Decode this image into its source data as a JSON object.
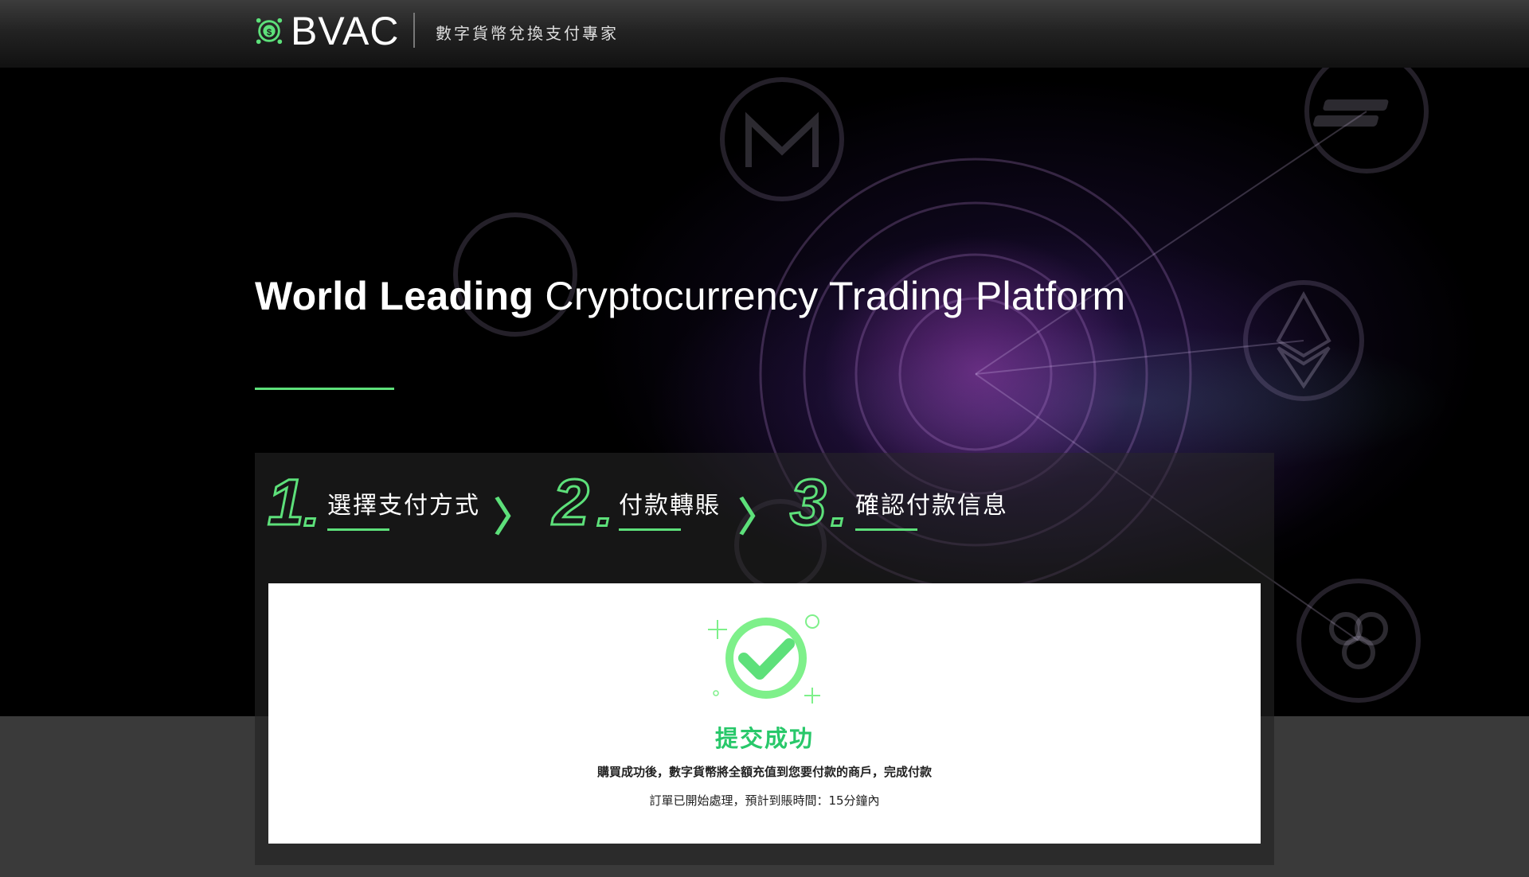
{
  "header": {
    "brand": "BVAC",
    "tagline": "數字貨幣兌換支付專家"
  },
  "hero": {
    "title_bold": "World Leading",
    "title_rest": "Cryptocurrency Trading Platform",
    "accent_color": "#5de07a"
  },
  "steps": [
    {
      "number": "1",
      "label": "選擇支付方式"
    },
    {
      "number": "2",
      "label": "付款轉賬"
    },
    {
      "number": "3",
      "label": "確認付款信息"
    }
  ],
  "step_separator": "〉",
  "result": {
    "icon": "check-circle-icon",
    "title": "提交成功",
    "message": "購買成功後，數字貨幣將全額充值到您要付款的商戶，完成付款",
    "status": "訂單已開始處理，預計到賬時間：15分鐘內"
  },
  "colors": {
    "success": "#28c86a",
    "accent": "#5de07a"
  }
}
